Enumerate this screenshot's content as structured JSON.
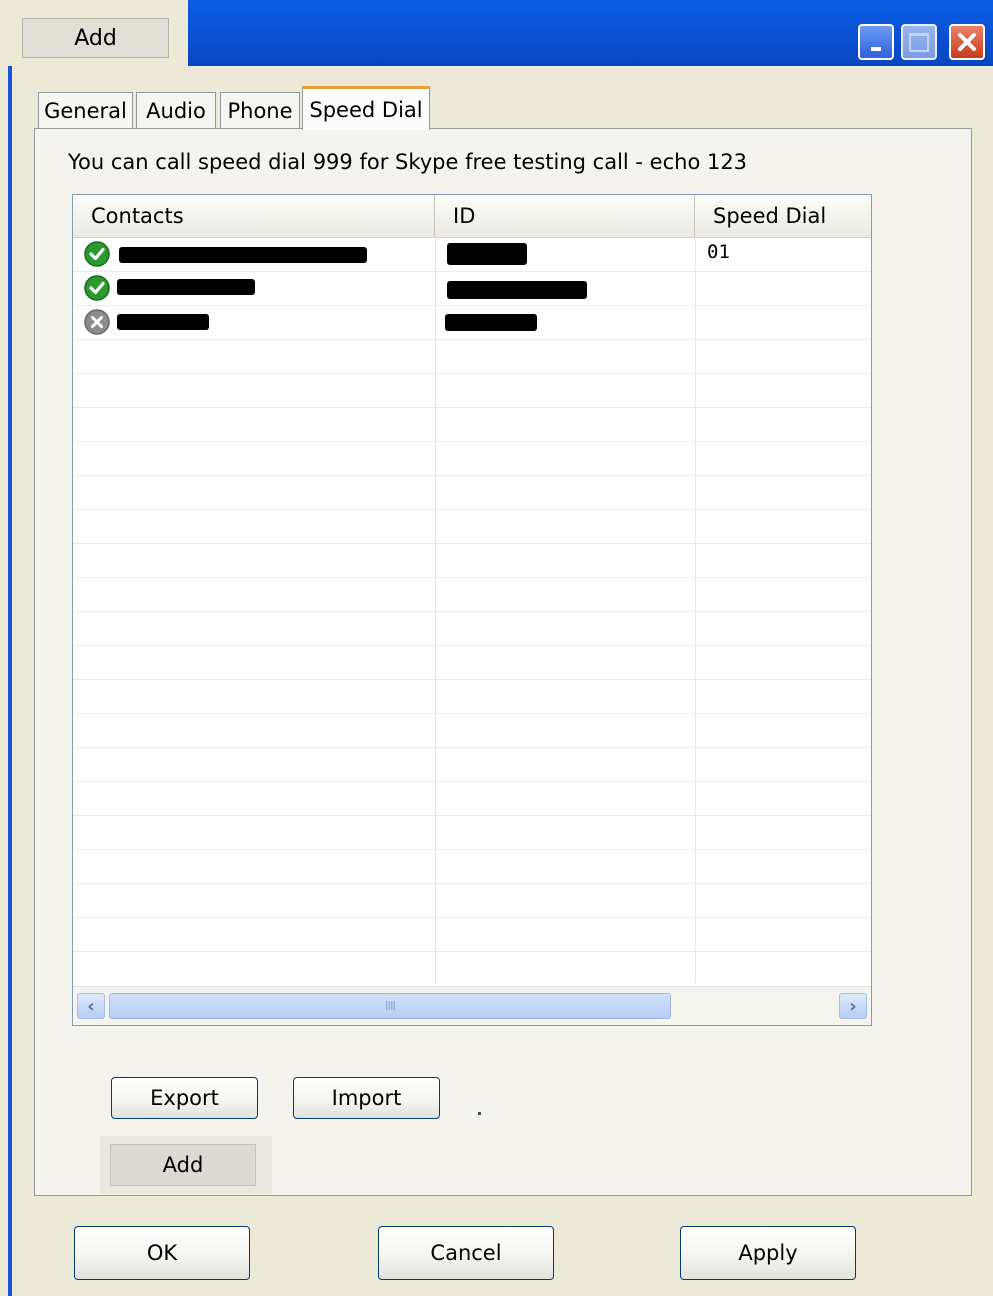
{
  "title_bar": {
    "add_button_label": "Add",
    "controls": {
      "minimize_icon": "minimize-icon",
      "maximize_icon": "maximize-icon",
      "close_icon": "close-icon"
    }
  },
  "tabs": [
    {
      "label": "General",
      "selected": false
    },
    {
      "label": "Audio",
      "selected": false
    },
    {
      "label": "Phone",
      "selected": false
    },
    {
      "label": "Speed Dial",
      "selected": true
    }
  ],
  "speed_dial": {
    "info_text": "You can call speed dial 999 for Skype free testing call - echo 123",
    "columns": {
      "contacts": "Contacts",
      "id": "ID",
      "speed_dial": "Speed Dial"
    },
    "rows": [
      {
        "status": "online",
        "status_icon": "online-check-icon",
        "contact": "[redacted]",
        "id": "[redacted]",
        "speed_dial": "01"
      },
      {
        "status": "online",
        "status_icon": "online-check-icon",
        "contact": "[redacted]",
        "id": "[redacted]",
        "speed_dial": ""
      },
      {
        "status": "offline",
        "status_icon": "offline-x-icon",
        "contact": "[redacted]",
        "id": "[redacted]",
        "speed_dial": ""
      }
    ],
    "scrollbar": {
      "left_icon": "chevron-left-icon",
      "right_icon": "chevron-right-icon",
      "grip": "IIII"
    }
  },
  "actions": {
    "export": "Export",
    "import": "Import",
    "add": "Add"
  },
  "footer": {
    "ok": "OK",
    "cancel": "Cancel",
    "apply": "Apply"
  },
  "colors": {
    "title_bar": "#0a5fe3",
    "window_bg": "#ece9d8",
    "selected_tab_accent": "#f0a030",
    "online": "#2b9a2f",
    "offline": "#8c8c8c"
  }
}
